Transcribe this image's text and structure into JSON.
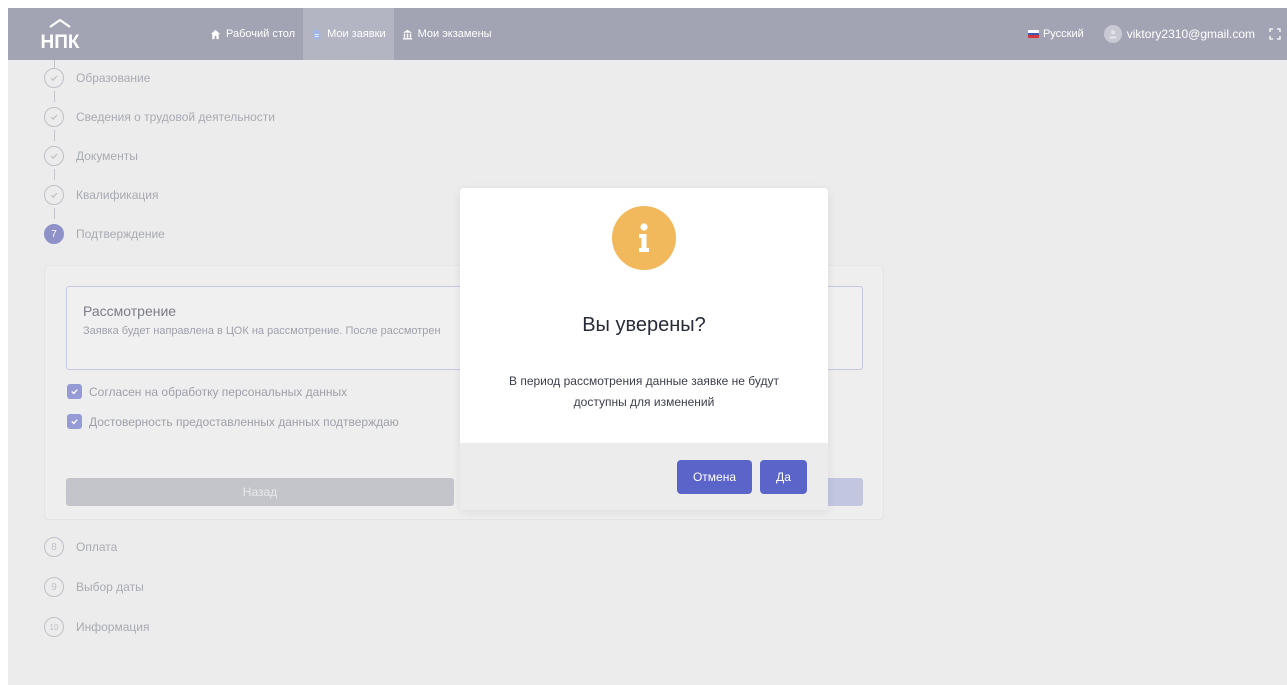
{
  "header": {
    "logo_text": "НПК",
    "nav": [
      {
        "label": "Рабочий стол",
        "icon": "home-icon"
      },
      {
        "label": "Мои заявки",
        "icon": "document-icon"
      },
      {
        "label": "Мои экзамены",
        "icon": "bank-icon"
      }
    ],
    "language": "Русский",
    "user_email": "viktory2310@gmail.com"
  },
  "steps_top": [
    {
      "label": "Образование"
    },
    {
      "label": "Сведения о трудовой деятельности"
    },
    {
      "label": "Документы"
    },
    {
      "label": "Квалификация"
    },
    {
      "label": "Подтверждение",
      "number": "7"
    }
  ],
  "steps_bottom": [
    {
      "label": "Оплата",
      "number": "8"
    },
    {
      "label": "Выбор даты",
      "number": "9"
    },
    {
      "label": "Информация",
      "number": "10"
    }
  ],
  "review": {
    "title": "Рассмотрение",
    "text": "Заявка будет направлена в ЦОК на рассмотрение. После рассмотрен"
  },
  "checkboxes": [
    {
      "label": "Согласен на обработку персональных данных",
      "checked": true
    },
    {
      "label": "Достоверность предоставленных данных подтверждаю",
      "checked": true
    }
  ],
  "back_label": "Назад",
  "modal": {
    "title": "Вы уверены?",
    "text": "В период рассмотрения данные заявке не будут доступны для изменений",
    "cancel_label": "Отмена",
    "confirm_label": "Да"
  },
  "colors": {
    "nav_bg": "#a2a4b3",
    "modal_button": "#5b64c8",
    "info_icon": "#f2b85c",
    "checkbox": "#969ad5"
  }
}
